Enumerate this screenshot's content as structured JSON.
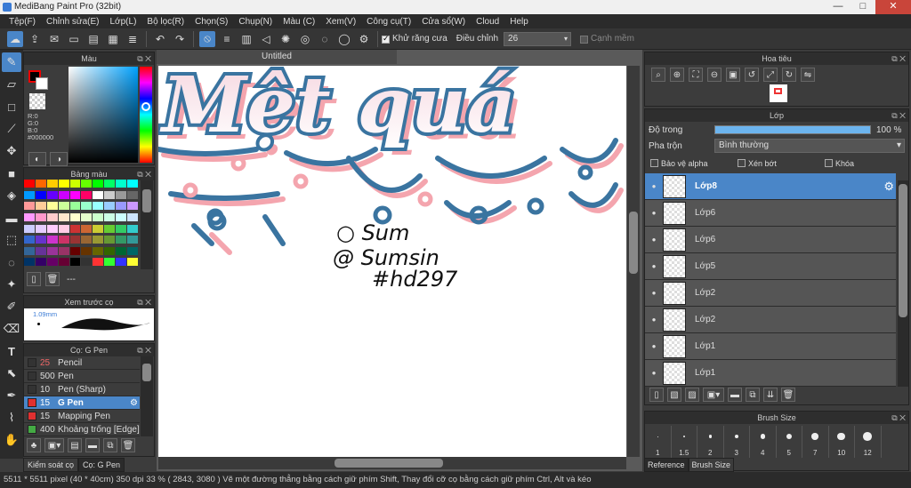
{
  "window": {
    "title": "MediBang Paint Pro (32bit)"
  },
  "menu": [
    "Tệp(F)",
    "Chỉnh sửa(E)",
    "Lớp(L)",
    "Bộ lọc(R)",
    "Chọn(S)",
    "Chụp(N)",
    "Màu (C)",
    "Xem(V)",
    "Công cụ(T)",
    "Cửa sổ(W)",
    "Cloud",
    "Help"
  ],
  "toolbar": {
    "antialias_label": "Khử răng cưa",
    "adjust_label": "Điều chỉnh",
    "adjust_value": "26",
    "edge_label": "Cạnh mềm"
  },
  "color_panel": {
    "title": "Màu",
    "r": "R:0",
    "g": "G:0",
    "b": "B:0",
    "hex": "#000000"
  },
  "palette_panel": {
    "title": "Bảng màu",
    "footer": "---"
  },
  "palette_colors": [
    "#ff0000",
    "#ff6600",
    "#ffcc00",
    "#ffff00",
    "#ccff00",
    "#66ff00",
    "#00ff00",
    "#00ff66",
    "#00ffcc",
    "#00ffff",
    "#0099ff",
    "#0000ff",
    "#6600ff",
    "#cc00ff",
    "#ff00ff",
    "#ff0066",
    "#ffffff",
    "#cccccc",
    "#999999",
    "#666666",
    "#ff9999",
    "#ffcc99",
    "#ffff99",
    "#ccff99",
    "#99ff99",
    "#99ffcc",
    "#99ffff",
    "#99ccff",
    "#9999ff",
    "#cc99ff",
    "#ff99ff",
    "#ff99cc",
    "#ffcccc",
    "#ffe5cc",
    "#ffffcc",
    "#e5ffcc",
    "#ccffcc",
    "#ccffe5",
    "#ccffff",
    "#cce5ff",
    "#ccccff",
    "#e5ccff",
    "#ffccff",
    "#ffcce5",
    "#cc3333",
    "#cc6633",
    "#cccc33",
    "#66cc33",
    "#33cc66",
    "#33cccc",
    "#3366cc",
    "#6633cc",
    "#cc33cc",
    "#cc3366",
    "#993333",
    "#996633",
    "#999933",
    "#669933",
    "#339966",
    "#339999",
    "#336699",
    "#663399",
    "#993399",
    "#993366",
    "#660000",
    "#663300",
    "#666600",
    "#336600",
    "#006633",
    "#006666",
    "#003366",
    "#330066",
    "#660066",
    "#660033",
    "#000000",
    "#333333",
    "#ff3333",
    "#33ff33",
    "#3333ff",
    "#ffff33"
  ],
  "brush_preview": {
    "title": "Xem trước cọ",
    "size": "1.09mm"
  },
  "brush_panel": {
    "title": "Cọ: G Pen",
    "items": [
      {
        "size": "25",
        "name": "Pencil",
        "color": "#333333"
      },
      {
        "size": "500",
        "name": "Pen",
        "color": "#333333"
      },
      {
        "size": "10",
        "name": "Pen (Sharp)",
        "color": "#333333"
      },
      {
        "size": "15",
        "name": "G Pen",
        "color": "#e03030"
      },
      {
        "size": "15",
        "name": "Mapping Pen",
        "color": "#e03030"
      },
      {
        "size": "400",
        "name": "Khoảng trống [Edge]",
        "color": "#44aa44"
      }
    ]
  },
  "bottom_tabs": [
    "Kiểm soát cọ",
    "Cọ: G Pen"
  ],
  "document": {
    "tab": "Untitled",
    "sig1": "○ Sum",
    "sig2": "@ Sumsin",
    "sig3": "#hd297",
    "big_text": "Mệt quá"
  },
  "navigator": {
    "title": "Hoa tiêu"
  },
  "layers_panel": {
    "title": "Lớp",
    "opacity_label": "Độ trong",
    "opacity_value": "100 %",
    "opacity": 1.0,
    "blend_label": "Pha trộn",
    "blend_value": "Bình thường",
    "protect_alpha": "Bảo vệ alpha",
    "clipping": "Xén bớt",
    "lock": "Khóa",
    "layers": [
      {
        "name": "Lớp8",
        "selected": true
      },
      {
        "name": "Lớp6"
      },
      {
        "name": "Lớp6"
      },
      {
        "name": "Lớp5"
      },
      {
        "name": "Lớp2"
      },
      {
        "name": "Lớp2"
      },
      {
        "name": "Lớp1"
      },
      {
        "name": "Lớp1"
      }
    ]
  },
  "brush_size_panel": {
    "title": "Brush Size",
    "sizes": [
      "1",
      "1.5",
      "2",
      "3",
      "4",
      "5",
      "7",
      "10",
      "12"
    ],
    "tabs": [
      "Reference",
      "Brush Size"
    ]
  },
  "status": {
    "text": "5511 * 5511 pixel  (40 * 40cm)  350 dpi  33 %  ( 2843, 3080 )  Vẽ một đường thẳng bằng cách giữ phím Shift, Thay đổi cỡ cọ bằng cách giữ phím Ctrl, Alt và kéo"
  }
}
